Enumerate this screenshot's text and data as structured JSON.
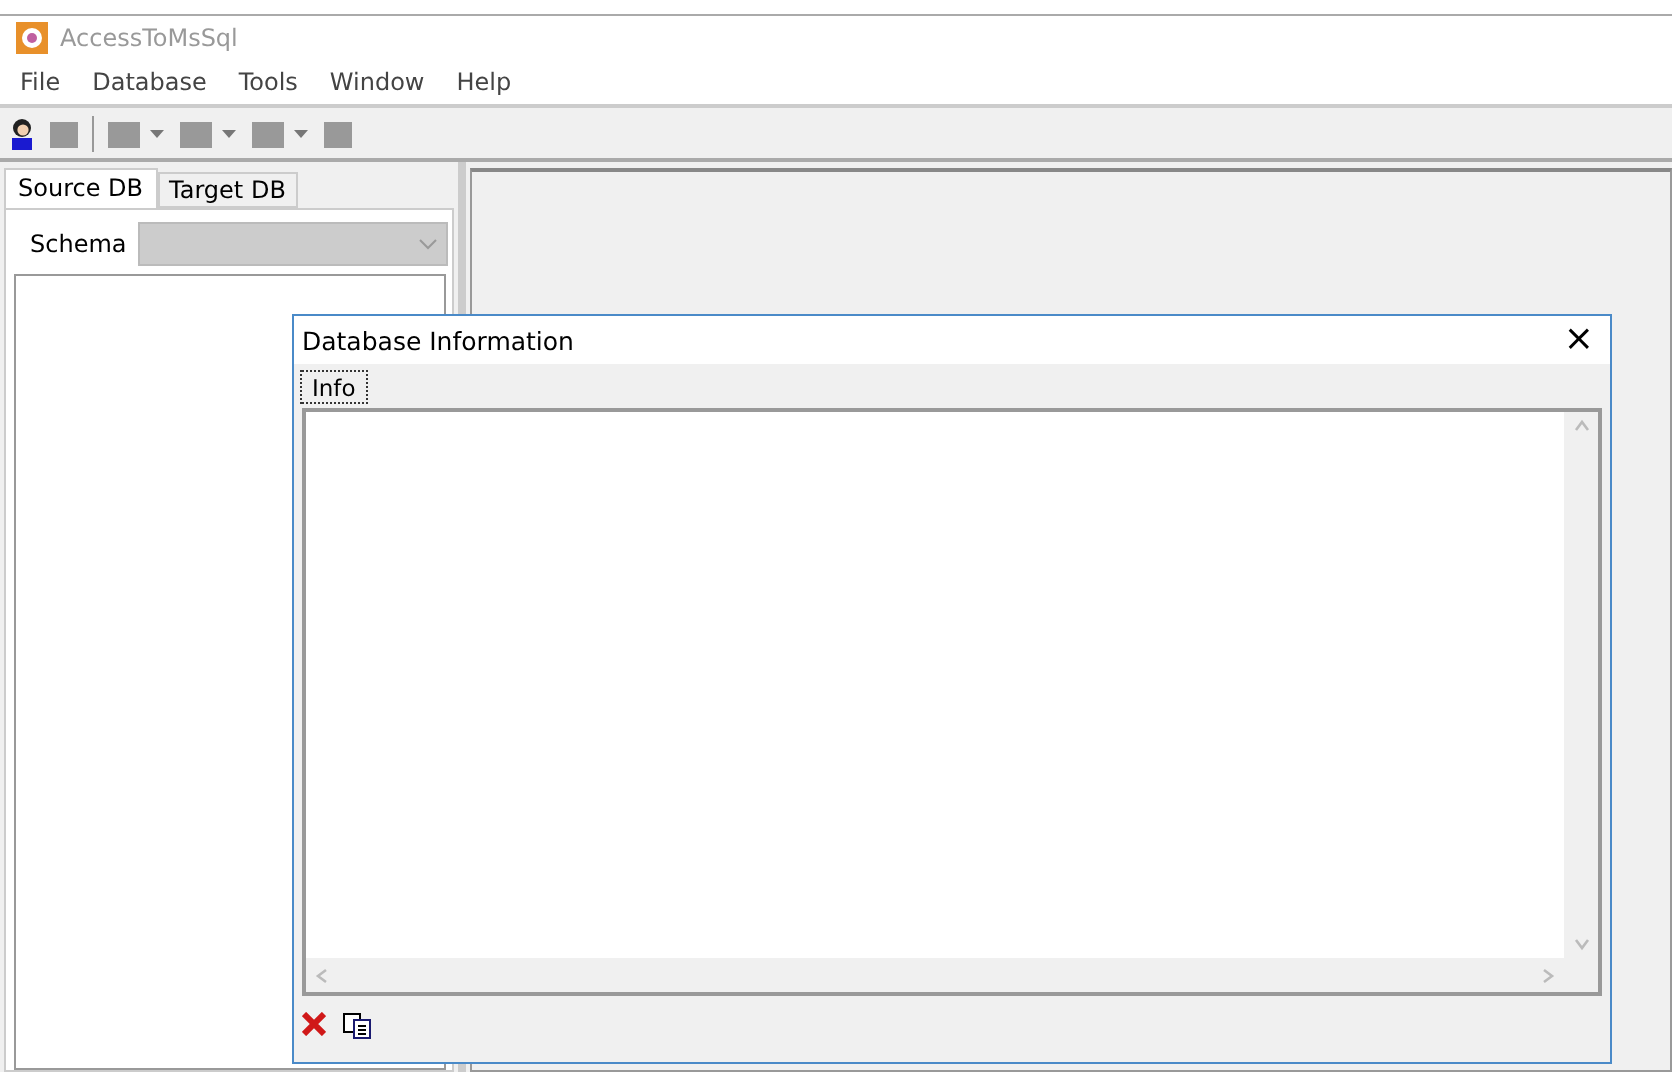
{
  "window": {
    "title": "AccessToMsSql"
  },
  "menu": [
    "File",
    "Database",
    "Tools",
    "Window",
    "Help"
  ],
  "toolbar": [
    {
      "kind": "button",
      "disabled": false
    },
    {
      "kind": "button",
      "disabled": true
    },
    {
      "kind": "separator"
    },
    {
      "kind": "dropdown",
      "disabled": true
    },
    {
      "kind": "dropdown",
      "disabled": true
    },
    {
      "kind": "dropdown",
      "disabled": true
    },
    {
      "kind": "button",
      "disabled": true
    }
  ],
  "left_panel": {
    "tabs": [
      {
        "label": "Source DB",
        "selected": true
      },
      {
        "label": "Target DB",
        "selected": false
      }
    ],
    "schema": {
      "label": "Schema",
      "disabled": true
    }
  },
  "dialog": {
    "title": "Database Information",
    "close": "×",
    "tabs": [
      {
        "label": "Info",
        "selected": true
      }
    ],
    "actions": [
      {
        "kind": "delete"
      },
      {
        "kind": "copy"
      }
    ]
  }
}
